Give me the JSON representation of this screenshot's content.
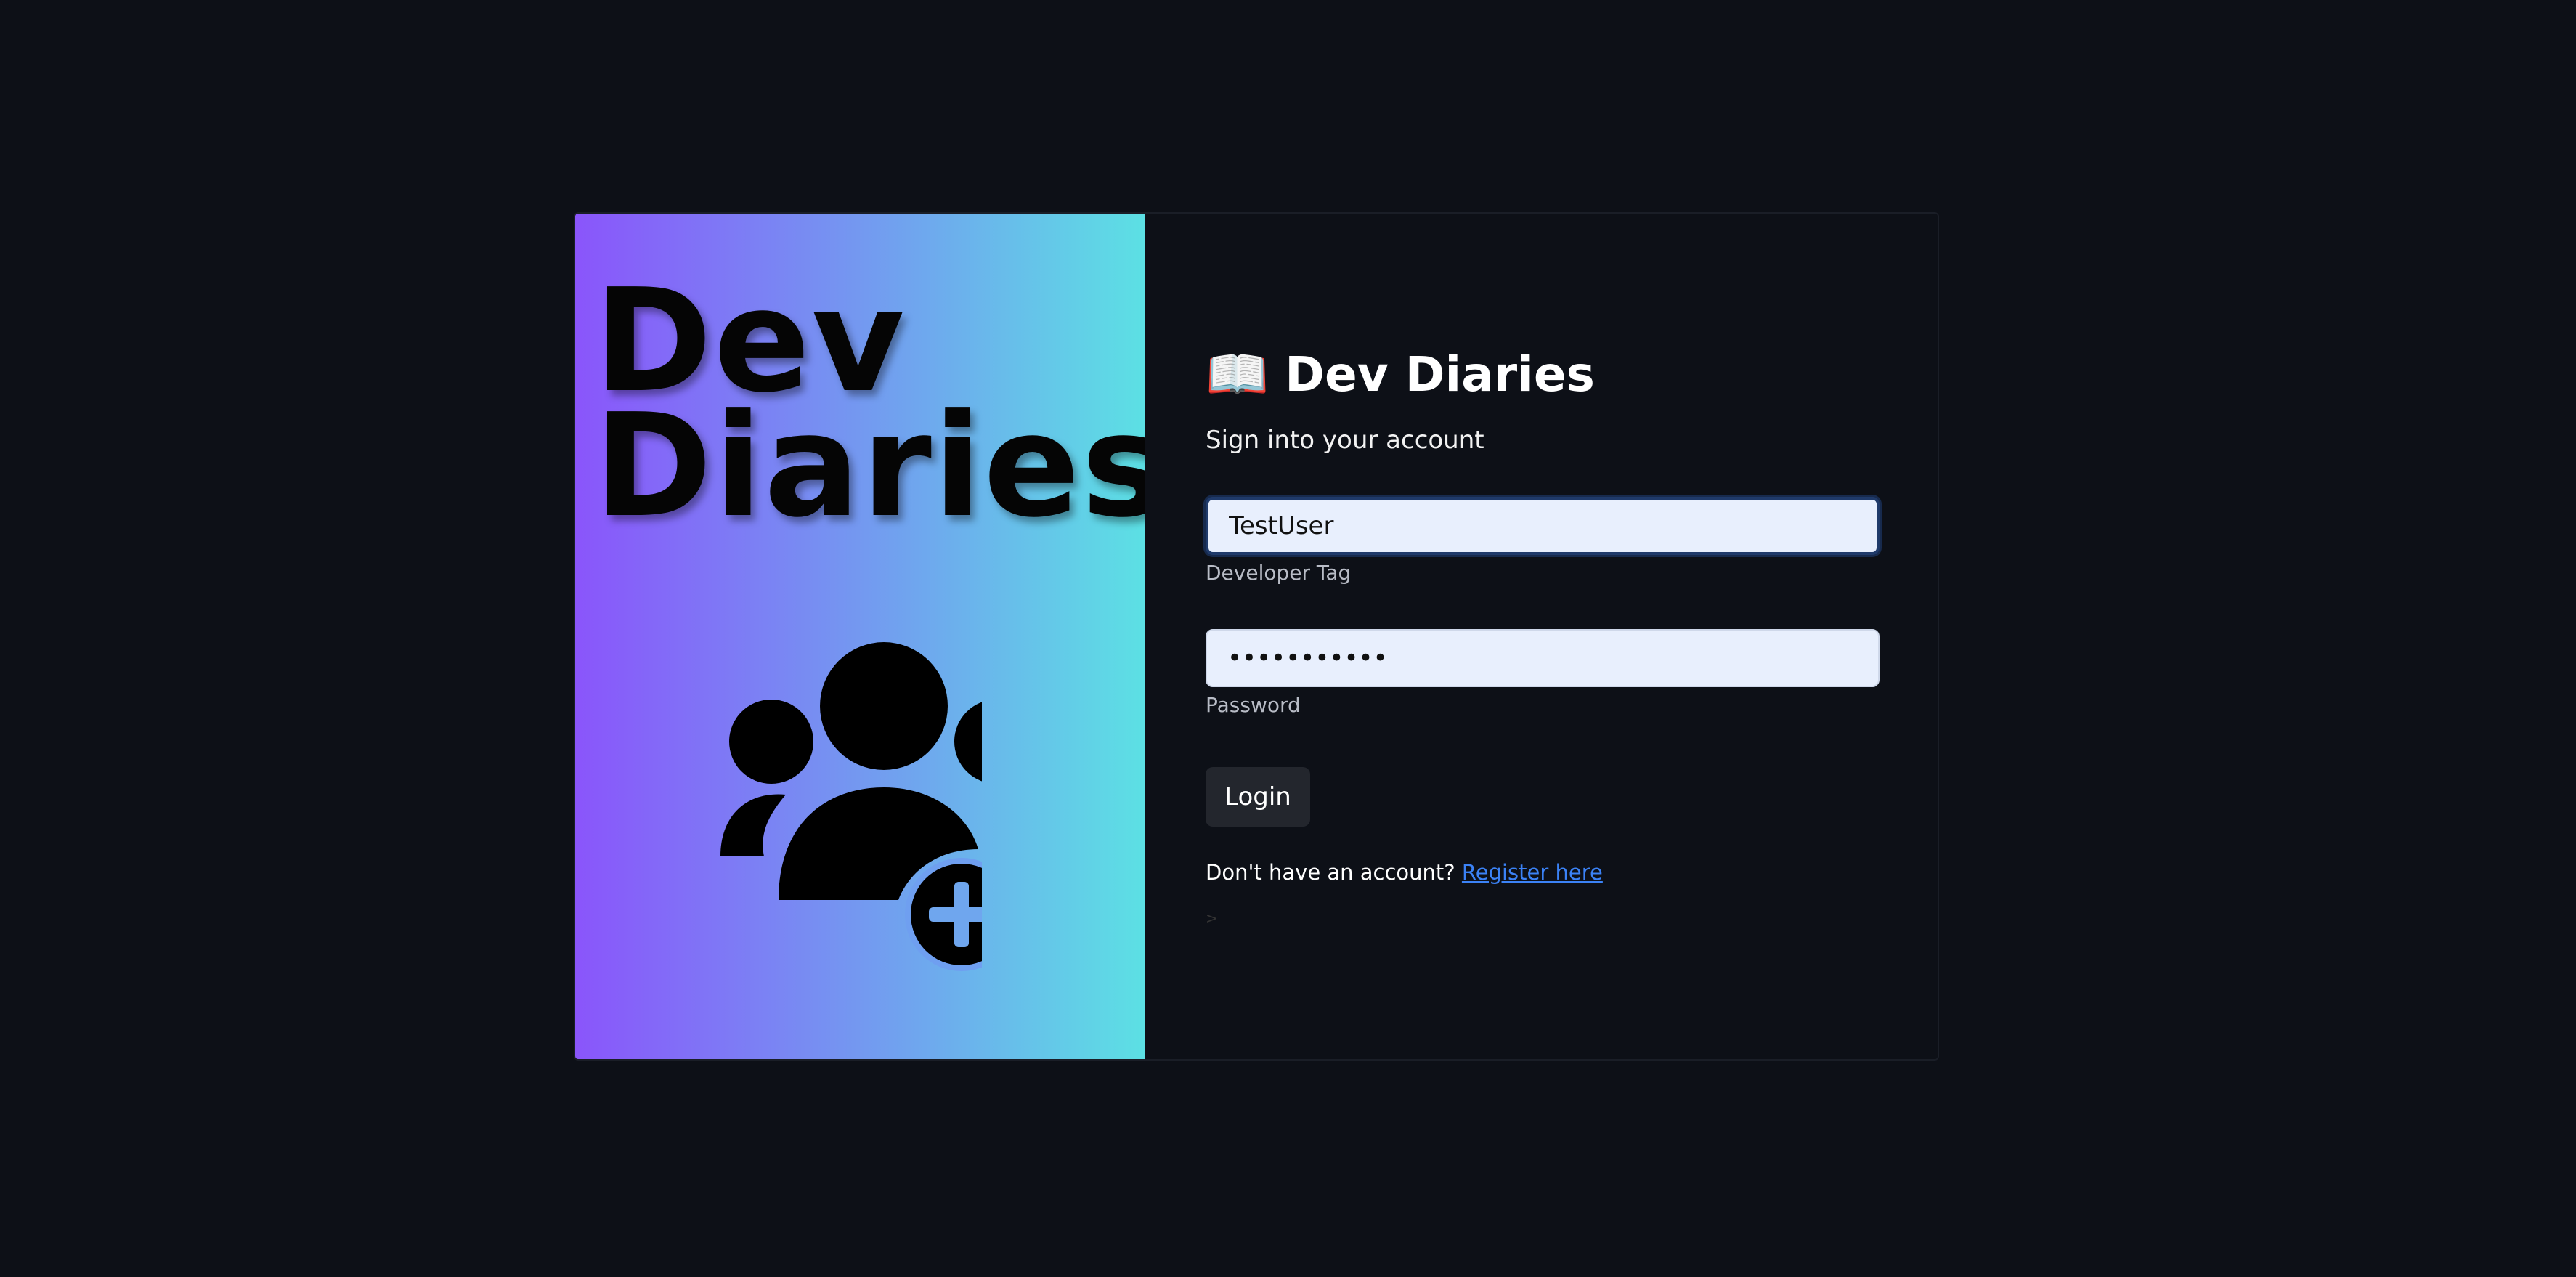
{
  "hero": {
    "title_line1": "Dev",
    "title_line2": "Diaries",
    "illustration_icon": "user-group-add-icon"
  },
  "brand": {
    "icon": "open-book-icon",
    "icon_glyph": "📖",
    "name": "Dev Diaries"
  },
  "subtitle": "Sign into your account",
  "form": {
    "username": {
      "value": "TestUser",
      "label": "Developer Tag"
    },
    "password": {
      "value": "•••••••••••",
      "label": "Password"
    },
    "login_label": "Login"
  },
  "register": {
    "prompt": "Don't have an account?",
    "link_text": "Register here"
  },
  "stray_text": ">",
  "colors": {
    "background": "#0d1017",
    "gradient_start": "#8a55fb",
    "gradient_end": "#5ce0e4",
    "input_bg": "#e8effd",
    "link": "#3b82f6",
    "button_bg": "#23262d"
  }
}
